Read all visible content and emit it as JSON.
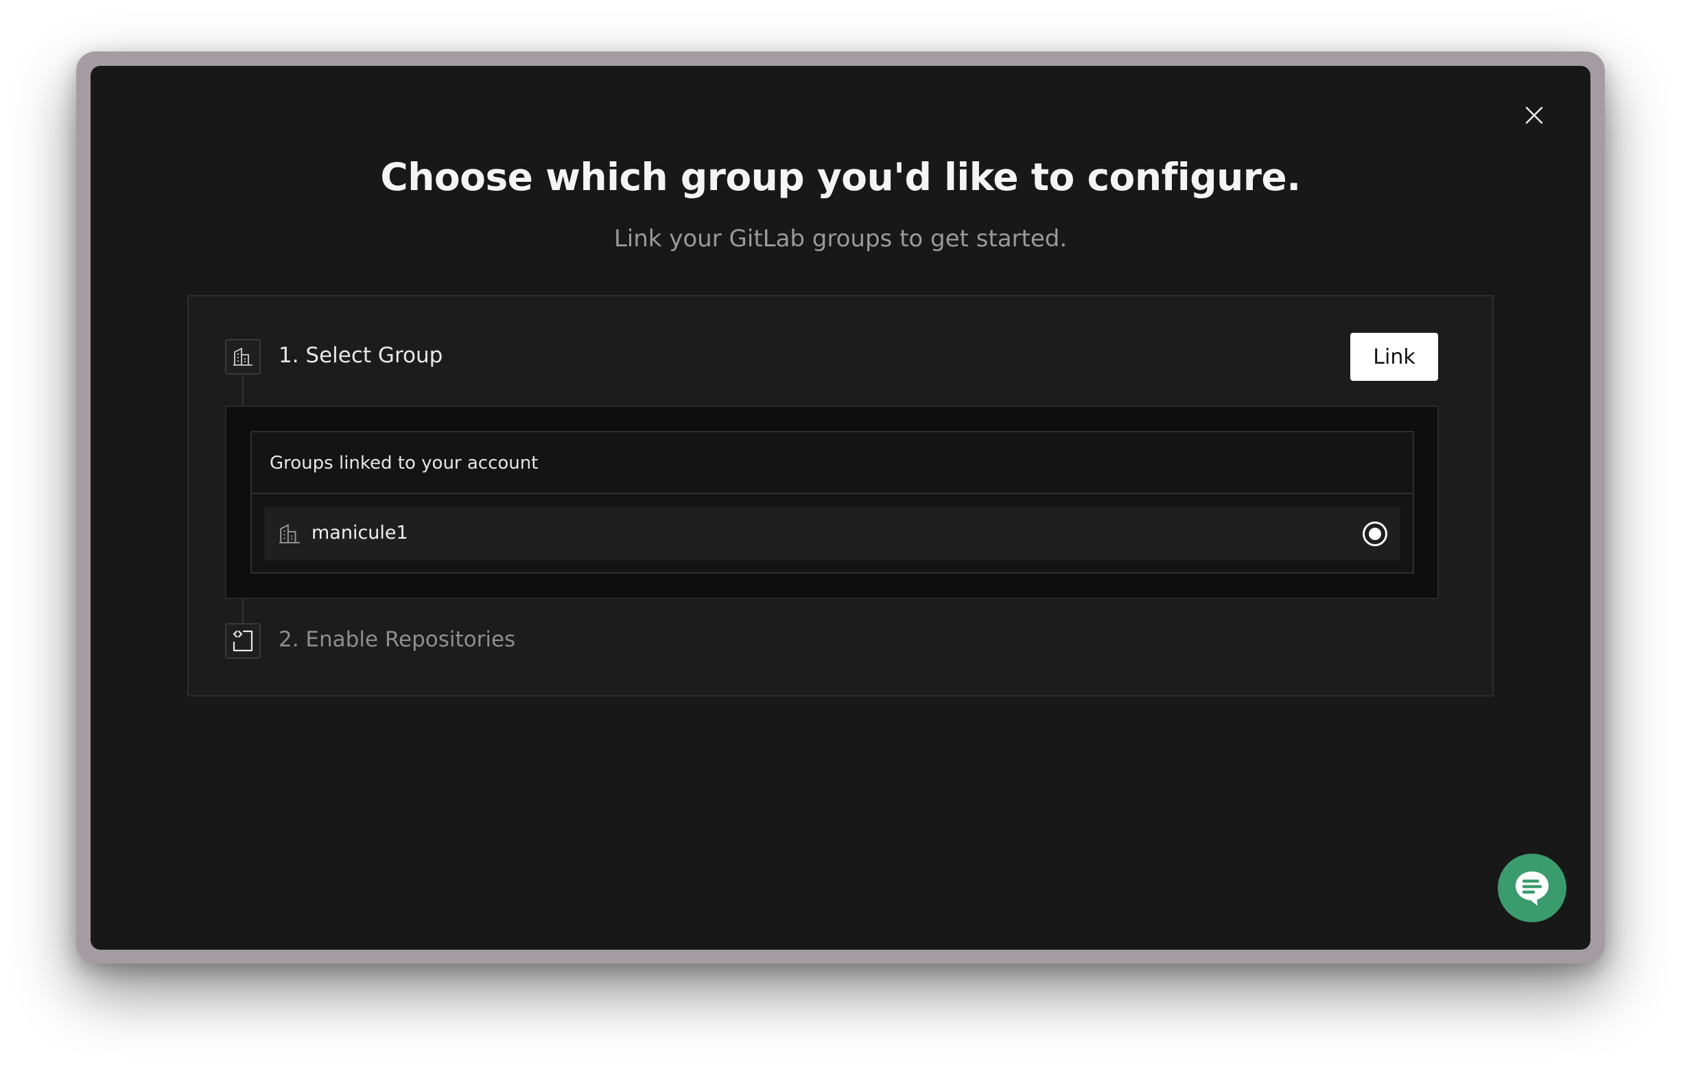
{
  "modal": {
    "title": "Choose which group you'd like to configure.",
    "subtitle": "Link your GitLab groups to get started.",
    "close_icon": "close-icon"
  },
  "steps": [
    {
      "label": "1. Select Group",
      "icon": "building-icon",
      "active": true
    },
    {
      "label": "2. Enable Repositories",
      "icon": "code-file-icon",
      "active": false
    }
  ],
  "link_button": {
    "label": "Link"
  },
  "groups": {
    "header": "Groups linked to your account",
    "items": [
      {
        "name": "manicule1",
        "icon": "building-icon",
        "selected": true
      }
    ]
  },
  "chat": {
    "icon": "chat-icon"
  },
  "colors": {
    "background": "#181818",
    "accent": "#3a9c6c",
    "button_bg": "#ffffff",
    "frame": "#a59ba2"
  }
}
